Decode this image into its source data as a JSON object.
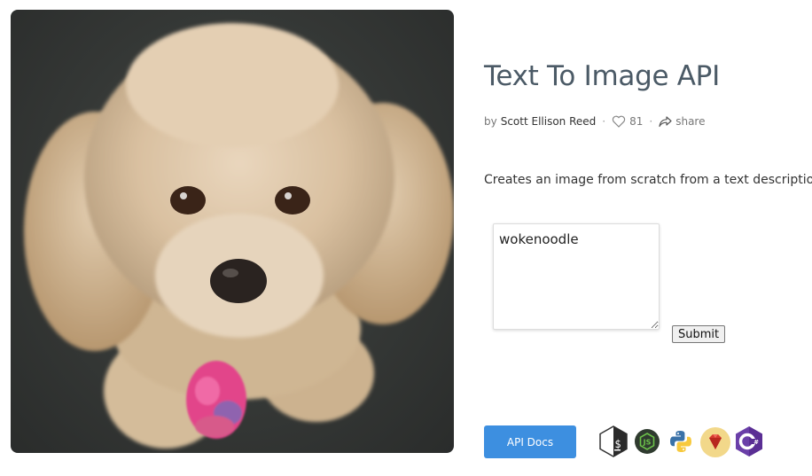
{
  "page": {
    "title": "Text To Image API",
    "author_prefix": "by",
    "author": "Scott Ellison Reed",
    "likes": "81",
    "share_label": "share",
    "description": "Creates an image from scratch from a text description."
  },
  "form": {
    "text_value": "wokenoodle",
    "submit_label": "Submit"
  },
  "footer": {
    "api_docs_label": "API Docs",
    "languages": [
      "shell-icon",
      "nodejs-icon",
      "python-icon",
      "ruby-icon",
      "csharp-icon"
    ]
  },
  "colors": {
    "title": "#4b5a66",
    "button_blue": "#3d8fe0"
  }
}
